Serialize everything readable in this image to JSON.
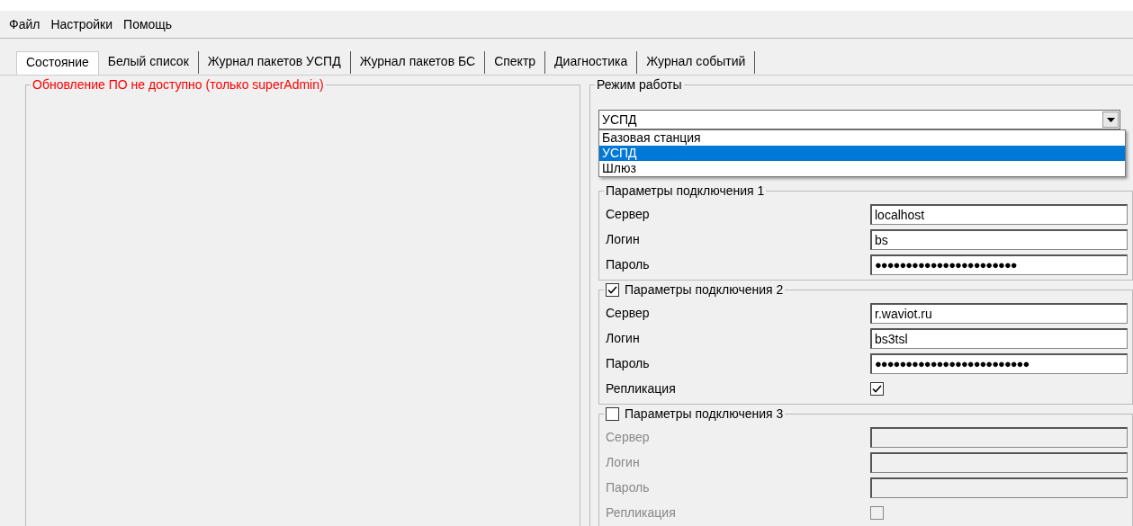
{
  "menu": [
    {
      "label": "Файл"
    },
    {
      "label": "Настройки"
    },
    {
      "label": "Помощь"
    }
  ],
  "tabs": [
    {
      "label": "Состояние",
      "selected": true
    },
    {
      "label": "Белый список",
      "selected": false
    },
    {
      "label": "Журнал пакетов УСПД",
      "selected": false
    },
    {
      "label": "Журнал пакетов БС",
      "selected": false
    },
    {
      "label": "Спектр",
      "selected": false
    },
    {
      "label": "Диагностика",
      "selected": false
    },
    {
      "label": "Журнал событий",
      "selected": false
    }
  ],
  "update_group": {
    "title": "Обновление ПО не доступно (только superAdmin)"
  },
  "mode_group": {
    "title": "Режим работы",
    "combo": {
      "value": "УСПД",
      "expanded": true,
      "options": [
        {
          "label": "Базовая станция",
          "selected": false
        },
        {
          "label": "УСПД",
          "selected": true
        },
        {
          "label": "Шлюз",
          "selected": false
        }
      ]
    }
  },
  "connections": [
    {
      "title": "Параметры подключения 1",
      "fields": [
        {
          "kind": "text",
          "label": "Сервер",
          "value": "localhost"
        },
        {
          "kind": "text",
          "label": "Логин",
          "value": "bs"
        },
        {
          "kind": "password",
          "label": "Пароль",
          "value": "●●●●●●●●●●●●●●●●●●●●●●●"
        }
      ]
    },
    {
      "title": "Параметры подключения 2",
      "checked": true,
      "fields": [
        {
          "kind": "text",
          "label": "Сервер",
          "value": "r.waviot.ru"
        },
        {
          "kind": "text",
          "label": "Логин",
          "value": "bs3tsl"
        },
        {
          "kind": "password",
          "label": "Пароль",
          "value": "●●●●●●●●●●●●●●●●●●●●●●●●●"
        },
        {
          "kind": "checkbox",
          "label": "Репликация",
          "checked": true
        }
      ]
    },
    {
      "title": "Параметры подключения 3",
      "checked": false,
      "fields": [
        {
          "kind": "text",
          "label": "Сервер"
        },
        {
          "kind": "text",
          "label": "Логин"
        },
        {
          "kind": "password",
          "label": "Пароль"
        },
        {
          "kind": "checkbox",
          "label": "Репликация",
          "checked": false
        }
      ]
    }
  ]
}
